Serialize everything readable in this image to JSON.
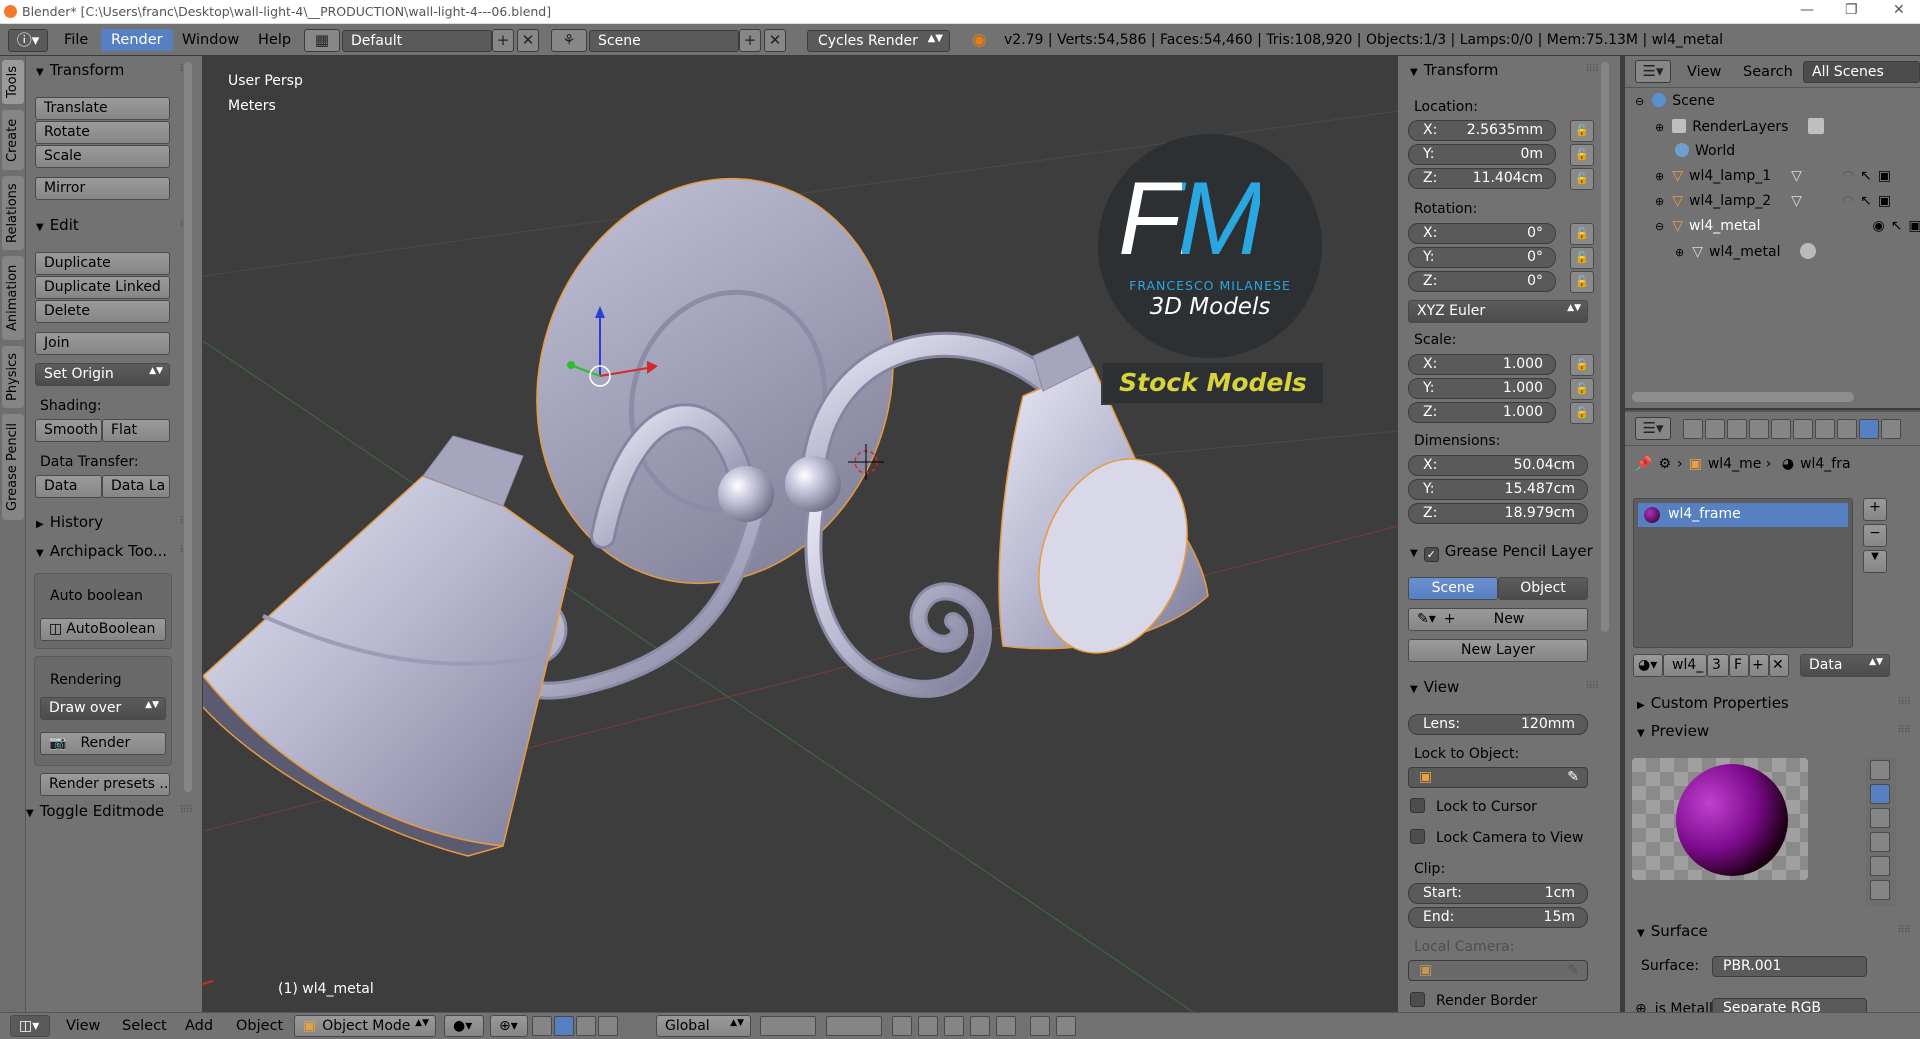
{
  "window": {
    "title": "Blender* [C:\\Users\\franc\\Desktop\\wall-light-4\\__PRODUCTION\\wall-light-4---06.blend]"
  },
  "topbar": {
    "menus": [
      "File",
      "Render",
      "Window",
      "Help"
    ],
    "active_menu": "Render",
    "layout": "Default",
    "scene": "Scene",
    "engine": "Cycles Render",
    "stats": "v2.79 | Verts:54,586 | Faces:54,460 | Tris:108,920 | Objects:1/3 | Lamps:0/0 | Mem:75.13M | wl4_metal"
  },
  "tabs": [
    "Tools",
    "Create",
    "Relations",
    "Animation",
    "Physics",
    "Grease Pencil"
  ],
  "toolshelf": {
    "transform": {
      "title": "Transform",
      "buttons": [
        "Translate",
        "Rotate",
        "Scale",
        "Mirror"
      ]
    },
    "edit": {
      "title": "Edit",
      "buttons": [
        "Duplicate",
        "Duplicate Linked",
        "Delete",
        "Join",
        "Set Origin"
      ]
    },
    "shading": {
      "label": "Shading:",
      "smooth": "Smooth",
      "flat": "Flat"
    },
    "data_transfer": {
      "label": "Data Transfer:",
      "data": "Data",
      "data_layout": "Data La"
    },
    "history": "History",
    "archipack": {
      "title": "Archipack Too...",
      "auto_boolean_label": "Auto boolean",
      "autoboolean_btn": "AutoBoolean",
      "rendering_label": "Rendering",
      "draw_over": "Draw over",
      "render_btn": "Render",
      "render_presets": "Render presets ..."
    },
    "toggle_editmode": "Toggle Editmode"
  },
  "viewport": {
    "view_name": "User Persp",
    "units": "Meters",
    "object_label": "(1) wl4_metal",
    "watermark": {
      "initials": "FM",
      "name": "FRANCESCO MILANESE",
      "sub": "3D Models",
      "badge": "Stock Models"
    }
  },
  "npanel": {
    "transform_title": "Transform",
    "location_label": "Location:",
    "location": [
      {
        "k": "X:",
        "v": "2.5635mm"
      },
      {
        "k": "Y:",
        "v": "0m"
      },
      {
        "k": "Z:",
        "v": "11.404cm"
      }
    ],
    "rotation_label": "Rotation:",
    "rotation": [
      {
        "k": "X:",
        "v": "0°"
      },
      {
        "k": "Y:",
        "v": "0°"
      },
      {
        "k": "Z:",
        "v": "0°"
      }
    ],
    "rotation_mode": "XYZ Euler",
    "scale_label": "Scale:",
    "scale": [
      {
        "k": "X:",
        "v": "1.000"
      },
      {
        "k": "Y:",
        "v": "1.000"
      },
      {
        "k": "Z:",
        "v": "1.000"
      }
    ],
    "dimensions_label": "Dimensions:",
    "dimensions": [
      {
        "k": "X:",
        "v": "50.04cm"
      },
      {
        "k": "Y:",
        "v": "15.487cm"
      },
      {
        "k": "Z:",
        "v": "18.979cm"
      }
    ],
    "grease_title": "Grease Pencil Layer",
    "grease_scene": "Scene",
    "grease_object": "Object",
    "grease_new": "New",
    "grease_new_layer": "New Layer",
    "view_title": "View",
    "lens_k": "Lens:",
    "lens_v": "120mm",
    "lock_to_object": "Lock to Object:",
    "lock_to_cursor": "Lock to Cursor",
    "lock_camera": "Lock Camera to View",
    "clip_label": "Clip:",
    "clip_start_k": "Start:",
    "clip_start_v": "1cm",
    "clip_end_k": "End:",
    "clip_end_v": "15m",
    "local_camera": "Local Camera:",
    "render_border": "Render Border"
  },
  "outliner": {
    "menus": [
      "View",
      "Search"
    ],
    "filter": "All Scenes",
    "items": [
      "Scene",
      "RenderLayers",
      "World",
      "wl4_lamp_1",
      "wl4_lamp_2",
      "wl4_metal",
      "wl4_metal"
    ]
  },
  "properties": {
    "breadcrumb": [
      "wl4_me",
      "wl4_fra"
    ],
    "material_slot": "wl4_frame",
    "mat_name": "wl4_",
    "mat_users": "3",
    "mat_fake": "F",
    "mat_link": "Data",
    "custom_props": "Custom Properties",
    "preview": "Preview",
    "surface_title": "Surface",
    "surface_label": "Surface:",
    "surface_value": "PBR.001",
    "is_metallic_label": "is Metallic",
    "is_metallic_value": "Separate RGB"
  },
  "bottombar": {
    "menus": [
      "View",
      "Select",
      "Add",
      "Object"
    ],
    "mode": "Object Mode",
    "orientation": "Global"
  }
}
